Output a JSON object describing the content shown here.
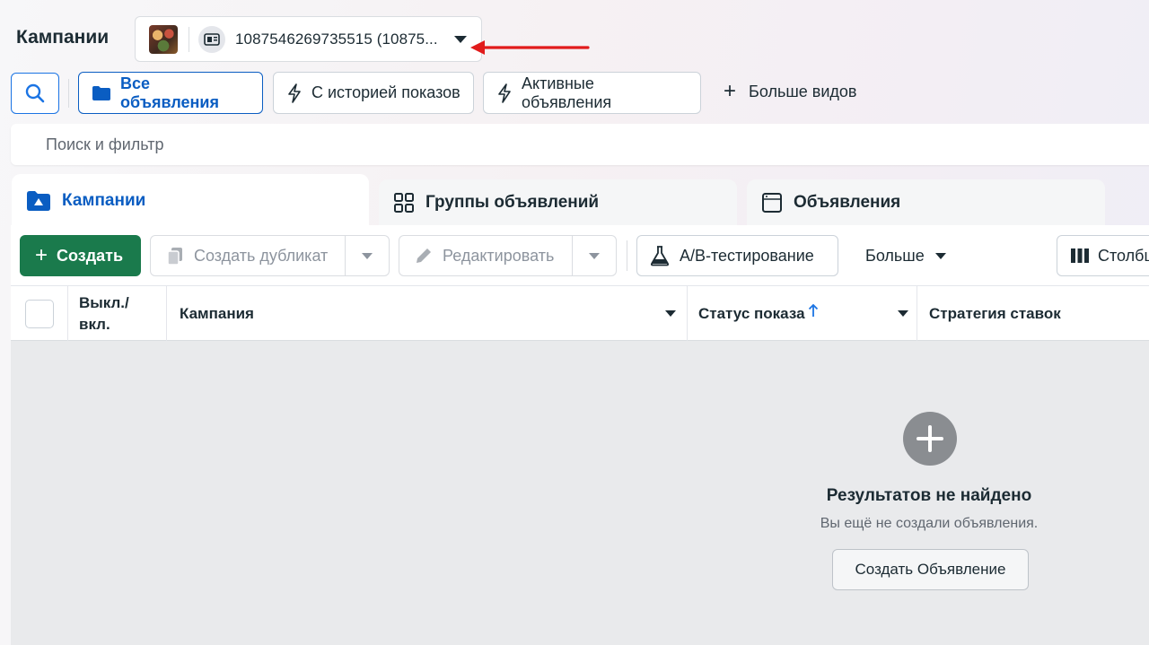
{
  "header": {
    "title": "Кампании",
    "account_label": "1087546269735515 (10875..."
  },
  "views": {
    "all_ads": "Все объявления",
    "with_history": "С историей показов",
    "active_ads": "Активные объявления",
    "more_views": "Больше видов"
  },
  "search": {
    "placeholder": "Поиск и фильтр"
  },
  "levels": {
    "campaigns": "Кампании",
    "ad_sets": "Группы объявлений",
    "ads": "Объявления"
  },
  "toolbar": {
    "create": "Создать",
    "duplicate": "Создать дубликат",
    "edit": "Редактировать",
    "ab_test": "A/B-тестирование",
    "more": "Больше",
    "columns": "Столбцы"
  },
  "table": {
    "headers": {
      "toggle": "Выкл./ вкл.",
      "campaign": "Кампания",
      "delivery_status": "Статус показа",
      "bid_strategy": "Стратегия ставок"
    }
  },
  "empty_state": {
    "title": "Результатов не найдено",
    "subtitle": "Вы ещё не создали объявления.",
    "button": "Создать Объявление"
  },
  "colors": {
    "accent": "#0a5dc2",
    "create_green": "#1a7a4c",
    "annotation_red": "#e11b1b"
  }
}
